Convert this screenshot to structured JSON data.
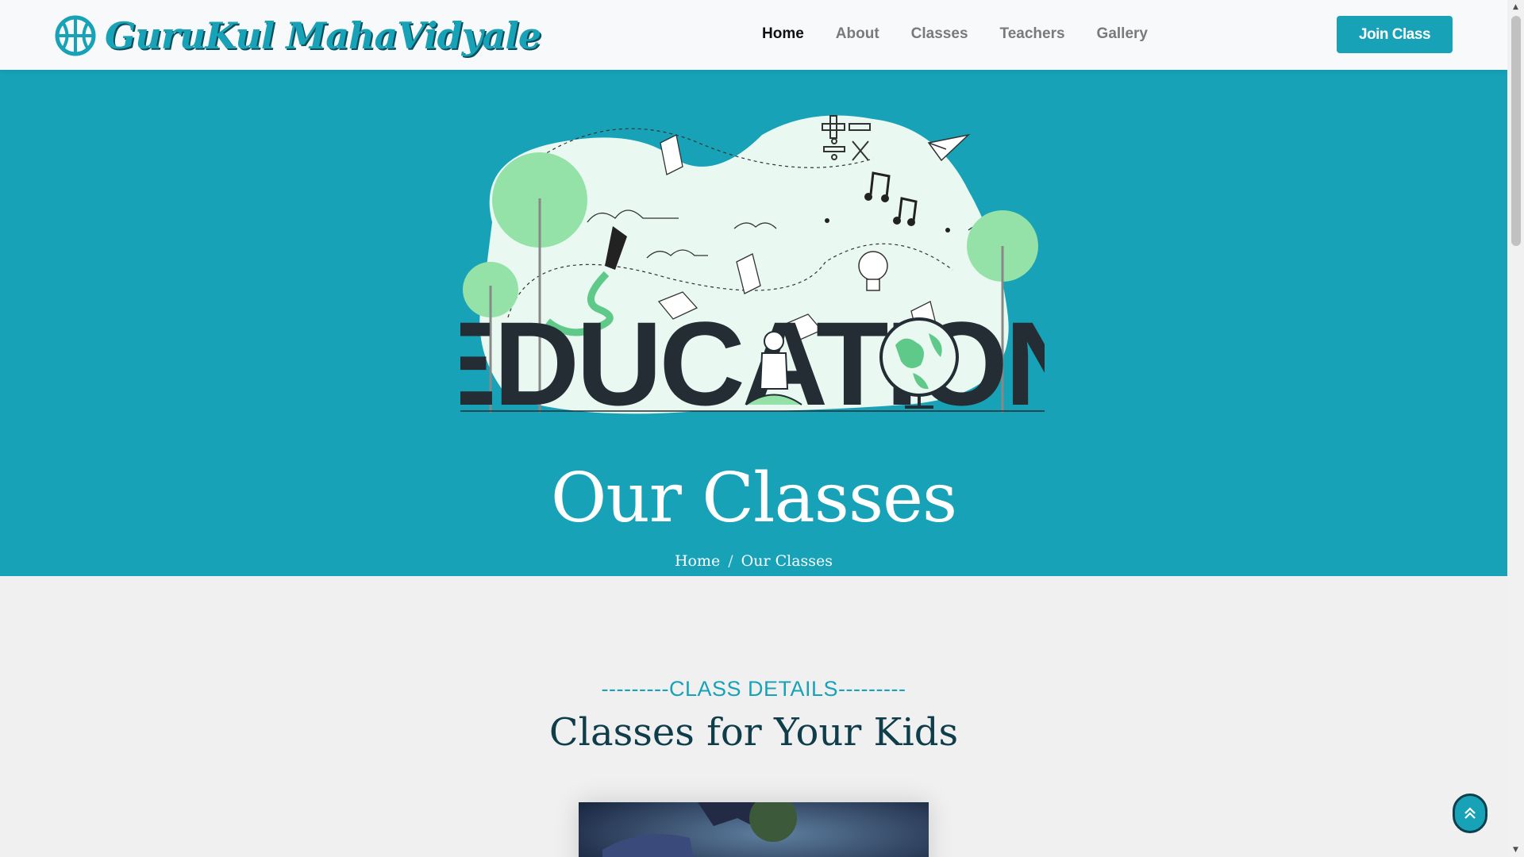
{
  "brand": {
    "name": "GuruKul MahaVidyale",
    "icon": "basketball-icon"
  },
  "nav": {
    "items": [
      {
        "label": "Home",
        "active": true
      },
      {
        "label": "About",
        "active": false
      },
      {
        "label": "Classes",
        "active": false
      },
      {
        "label": "Teachers",
        "active": false
      },
      {
        "label": "Gallery",
        "active": false
      }
    ],
    "cta_label": "Join Class"
  },
  "hero": {
    "illustration_word": "EDUCATION",
    "title": "Our Classes",
    "breadcrumb": {
      "home": "Home",
      "separator": "/",
      "current": "Our Classes"
    }
  },
  "section": {
    "subtitle": "---------CLASS DETAILS---------",
    "title": "Classes for Your Kids"
  },
  "colors": {
    "primary": "#17a2b8",
    "dark": "#0f3d4a",
    "navbar_bg": "#f8f9fa",
    "page_bg": "#f0f0f0"
  },
  "icons": {
    "back_to_top": "double-chevron-up-icon"
  }
}
